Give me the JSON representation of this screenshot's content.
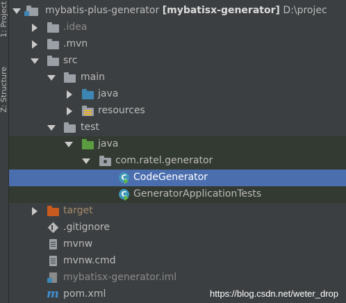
{
  "side_panel": {
    "project_tab": "1: Project",
    "structure_tab": "Z: Structure"
  },
  "tree": {
    "root": {
      "name": "mybatis-plus-generator",
      "module": "[mybatisx-generator]",
      "path": "D:\\projec"
    },
    "items": {
      "idea": ".idea",
      "mvn": ".mvn",
      "src": "src",
      "main": "main",
      "main_java": "java",
      "resources": "resources",
      "test": "test",
      "test_java": "java",
      "package": "com.ratel.generator",
      "code_generator": "CodeGenerator",
      "generator_tests": "GeneratorApplicationTests",
      "target": "target",
      "gitignore": ".gitignore",
      "mvnw": "mvnw",
      "mvnw_cmd": "mvnw.cmd",
      "iml": "mybatisx-generator.iml",
      "pom": "pom.xml"
    },
    "selected_item": "CodeGenerator"
  },
  "watermark": "https://blog.csdn.net/weter_drop",
  "icons": {
    "maven_glyph": "m",
    "class_glyph": "C"
  },
  "colors": {
    "background": "#3c3f41",
    "selection": "#4b6eaf",
    "test_band": "#333a31",
    "source_folder": "#3d86b4",
    "test_folder": "#5a9c3f",
    "excluded_folder": "#c75a1f"
  }
}
